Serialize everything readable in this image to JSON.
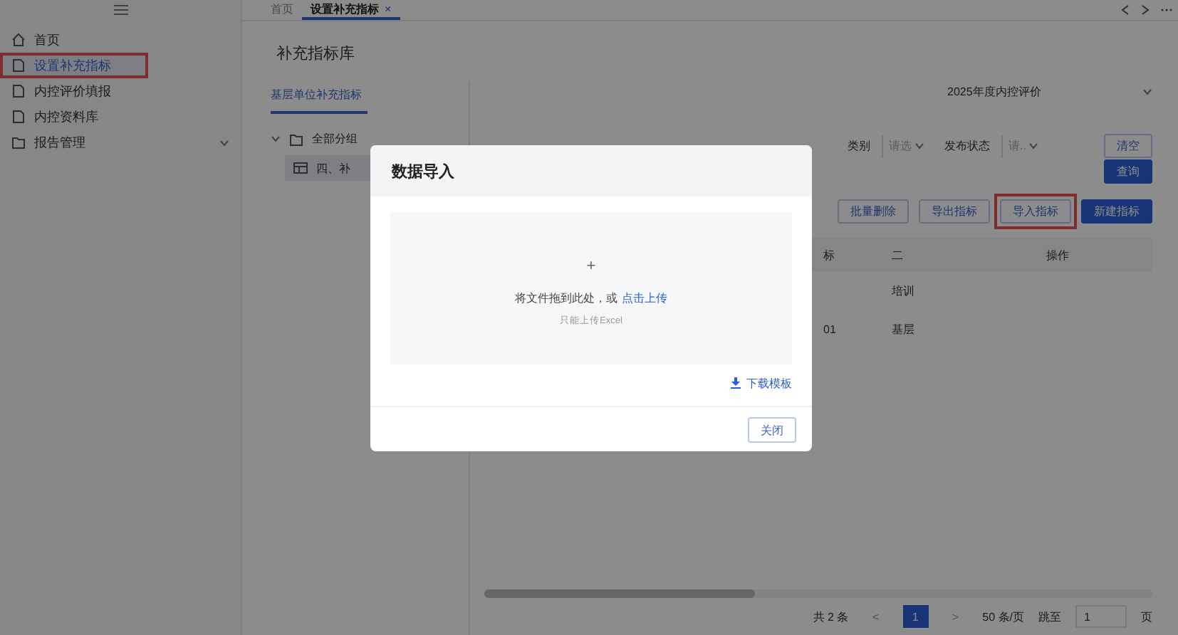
{
  "sidebar": {
    "items": [
      {
        "label": "首页",
        "kind": "home",
        "selected": false,
        "annotated": false
      },
      {
        "label": "设置补充指标",
        "kind": "page",
        "selected": true,
        "annotated": true
      },
      {
        "label": "内控评价填报",
        "kind": "page",
        "selected": false,
        "annotated": false
      },
      {
        "label": "内控资料库",
        "kind": "page",
        "selected": false,
        "annotated": false
      },
      {
        "label": "报告管理",
        "kind": "group",
        "selected": false,
        "annotated": false,
        "expanded": false
      }
    ]
  },
  "tabs": [
    {
      "label": "首页",
      "selected": false
    },
    {
      "label": "设置补充指标",
      "selected": true,
      "close": "×"
    }
  ],
  "page_title": "补充指标库",
  "subtabs": [
    {
      "label": "基层单位补充指标",
      "selected": true
    }
  ],
  "tree": {
    "label": "全部分组",
    "expanded": true,
    "children": [
      {
        "label": "四、补",
        "selected": true
      }
    ]
  },
  "year_select": {
    "value": "2025年度内控评价"
  },
  "filters": [
    {
      "label": "类别",
      "placeholder": "请选"
    },
    {
      "label": "发布状态",
      "placeholder": "请.."
    }
  ],
  "filter_buttons": [
    {
      "label": "清空",
      "kind": "default"
    },
    {
      "label": "查询",
      "kind": "primary"
    }
  ],
  "actions": [
    {
      "label": "批量删除",
      "kind": "default",
      "annotated": false
    },
    {
      "label": "导出指标",
      "kind": "default",
      "annotated": false
    },
    {
      "label": "导入指标",
      "kind": "default",
      "annotated": true
    },
    {
      "label": "新建指标",
      "kind": "primary",
      "annotated": false
    }
  ],
  "table": {
    "columns": [
      "标",
      "二",
      "操作"
    ],
    "rows": [
      [
        "",
        "培训"
      ],
      [
        "01",
        "基层"
      ]
    ]
  },
  "pagination": {
    "total": "共 2 条",
    "prev": "<",
    "pages": [
      {
        "label": "1",
        "selected": true
      }
    ],
    "next": ">",
    "page_size": "50 条/页",
    "jump_label": "跳至",
    "jump_value": "1",
    "unit": "页"
  },
  "dialog": {
    "title": "数据导入",
    "plus": "+",
    "drop_text": "将文件拖到此处，或",
    "upload_link": "点击上传",
    "hint": "只能上传Excel",
    "download": "下载模板",
    "close_button": "关闭"
  }
}
